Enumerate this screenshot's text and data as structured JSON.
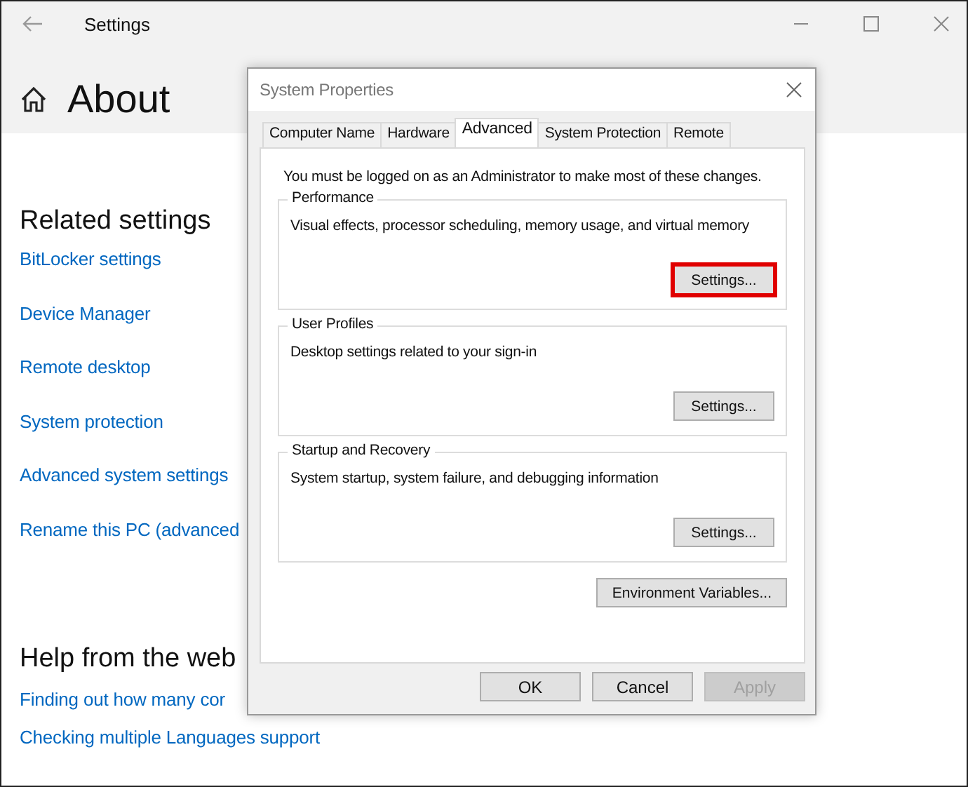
{
  "settings_window": {
    "title": "Settings",
    "page_title": "About",
    "sections": [
      {
        "heading": "Related settings",
        "links": [
          "BitLocker settings",
          "Device Manager",
          "Remote desktop",
          "System protection",
          "Advanced system settings",
          "Rename this PC (advanced"
        ]
      },
      {
        "heading": "Help from the web",
        "links": [
          "Finding out how many cor",
          "Checking multiple Languages support"
        ]
      }
    ]
  },
  "dialog": {
    "title": "System Properties",
    "tabs": [
      {
        "label": "Computer Name",
        "selected": false
      },
      {
        "label": "Hardware",
        "selected": false
      },
      {
        "label": "Advanced",
        "selected": true
      },
      {
        "label": "System Protection",
        "selected": false
      },
      {
        "label": "Remote",
        "selected": false
      }
    ],
    "notice": "You must be logged on as an Administrator to make most of these changes.",
    "groups": [
      {
        "title": "Performance",
        "description": "Visual effects, processor scheduling, memory usage, and virtual memory",
        "button": {
          "label": "Settings...",
          "highlighted": true
        }
      },
      {
        "title": "User Profiles",
        "description": "Desktop settings related to your sign-in",
        "button": {
          "label": "Settings...",
          "highlighted": false
        }
      },
      {
        "title": "Startup and Recovery",
        "description": "System startup, system failure, and debugging information",
        "button": {
          "label": "Settings...",
          "highlighted": false
        }
      }
    ],
    "extra_button": "Environment Variables...",
    "footer_buttons": [
      {
        "label": "OK",
        "disabled": false
      },
      {
        "label": "Cancel",
        "disabled": false
      },
      {
        "label": "Apply",
        "disabled": true
      }
    ]
  }
}
